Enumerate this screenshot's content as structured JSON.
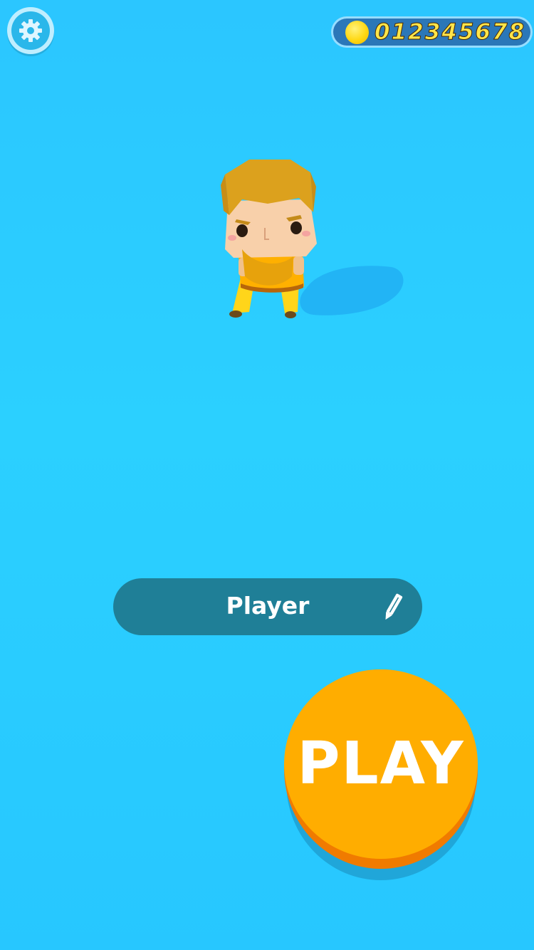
{
  "header": {
    "settings_icon": "gear-icon",
    "coin_icon": "coin-icon",
    "coin_count": "012345678"
  },
  "player": {
    "name": "Player",
    "edit_icon": "pencil-icon"
  },
  "actions": {
    "play_label": "PLAY"
  },
  "colors": {
    "background": "#2bc6ff",
    "name_bar": "#1f7f97",
    "play_button": "#ffad00",
    "coin_text": "#ffe54a"
  }
}
